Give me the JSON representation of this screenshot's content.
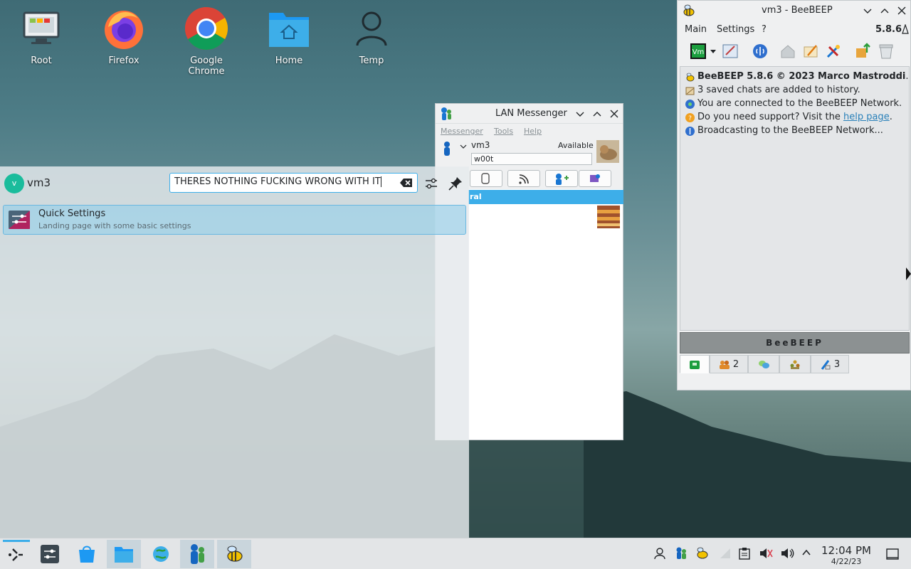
{
  "desktop": {
    "icons": [
      {
        "label": "Root",
        "icon": "computer-icon"
      },
      {
        "label": "Firefox",
        "icon": "firefox-icon"
      },
      {
        "label": "Google Chrome",
        "icon": "chrome-icon"
      },
      {
        "label": "Home",
        "icon": "home-folder-icon"
      },
      {
        "label": "Temp",
        "icon": "user-icon"
      }
    ]
  },
  "launcher": {
    "username": "vm3",
    "avatar_letter": "v",
    "search_value": "THERES NOTHING FUCKING WRONG WITH IT",
    "results": [
      {
        "title": "Quick Settings",
        "subtitle": "Landing page with some basic settings",
        "icon": "settings-icon"
      }
    ],
    "accent": "#3daee9"
  },
  "lan": {
    "title": "LAN Messenger",
    "menu": [
      "Messenger",
      "Tools",
      "Help"
    ],
    "user": "vm3",
    "status": "Available",
    "note": "w00t",
    "group_label": "ral"
  },
  "bee": {
    "title": "vm3 - BeeBEEP",
    "menu": [
      "Main",
      "Settings",
      "?"
    ],
    "version": "5.8.6",
    "log": [
      {
        "bold": "BeeBEEP 5.8.6 © 2023 Marco Mastroddi",
        "text": ".",
        "icon": "bee-icon"
      },
      {
        "text": "3 saved chats are added to history.",
        "icon": "history-icon"
      },
      {
        "text": "You are connected to the BeeBEEP Network.",
        "icon": "network-icon"
      },
      {
        "text": "Do you need support? Visit the ",
        "link": "help page",
        "after": ".",
        "icon": "help-icon"
      },
      {
        "text": "Broadcasting to the BeeBEEP Network...",
        "icon": "broadcast-icon"
      }
    ],
    "banner": "BeeBEEP",
    "tabs": [
      {
        "label": "",
        "icon": "home-tab-icon"
      },
      {
        "label": "2",
        "icon": "users-icon"
      },
      {
        "label": "",
        "icon": "chat-icon"
      },
      {
        "label": "",
        "icon": "groups-icon"
      },
      {
        "label": "3",
        "icon": "files-icon"
      }
    ]
  },
  "taskbar": {
    "time": "12:04 PM",
    "date": "4/22/23"
  }
}
